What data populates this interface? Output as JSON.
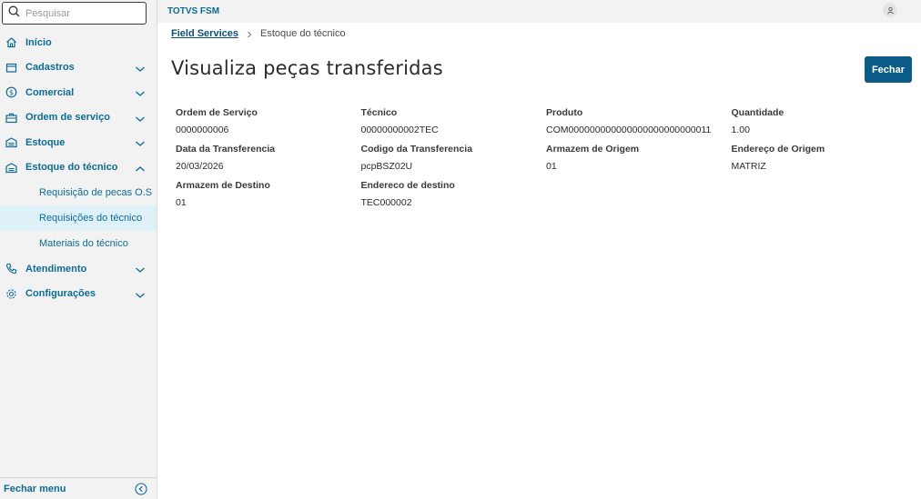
{
  "search": {
    "placeholder": "Pesquisar"
  },
  "topbar": {
    "title": "TOTVS FSM"
  },
  "sidebar": {
    "items": [
      {
        "label": "Início",
        "icon": "home-icon"
      },
      {
        "label": "Cadastros",
        "icon": "register-icon"
      },
      {
        "label": "Comercial",
        "icon": "dollar-icon"
      },
      {
        "label": "Ordem de serviço",
        "icon": "toolbox-icon"
      },
      {
        "label": "Estoque",
        "icon": "warehouse-icon"
      },
      {
        "label": "Estoque do técnico",
        "icon": "warehouse-icon"
      },
      {
        "label": "Atendimento",
        "icon": "phone-icon"
      },
      {
        "label": "Configurações",
        "icon": "gear-icon"
      }
    ],
    "subitems": [
      {
        "label": "Requisição de pecas O.S"
      },
      {
        "label": "Requisições do técnico"
      },
      {
        "label": "Materiais do técnico"
      }
    ],
    "footer": "Fechar menu"
  },
  "breadcrumb": {
    "root": "Field Services",
    "current": "Estoque do técnico"
  },
  "page": {
    "title": "Visualiza peças transferidas",
    "close_label": "Fechar"
  },
  "details": {
    "fields": [
      {
        "label": "Ordem de Serviço",
        "value": "0000000006"
      },
      {
        "label": "Técnico",
        "value": "00000000002TEC"
      },
      {
        "label": "Produto",
        "value": "COM000000000000000000000000011"
      },
      {
        "label": "Quantidade",
        "value": "1.00"
      },
      {
        "label": "Data da Transferencia",
        "value": "20/03/2026"
      },
      {
        "label": "Codigo da Transferencia",
        "value": "pcpBSZ02U"
      },
      {
        "label": "Armazem de Origem",
        "value": "01"
      },
      {
        "label": "Endereço de Origem",
        "value": "MATRIZ"
      },
      {
        "label": "Armazem de Destino",
        "value": "01"
      },
      {
        "label": "Endereco de destino",
        "value": "TEC000002"
      }
    ]
  },
  "colors": {
    "accent": "#0c6c94",
    "button": "#0c5b86",
    "active_bg": "#def1f8"
  }
}
